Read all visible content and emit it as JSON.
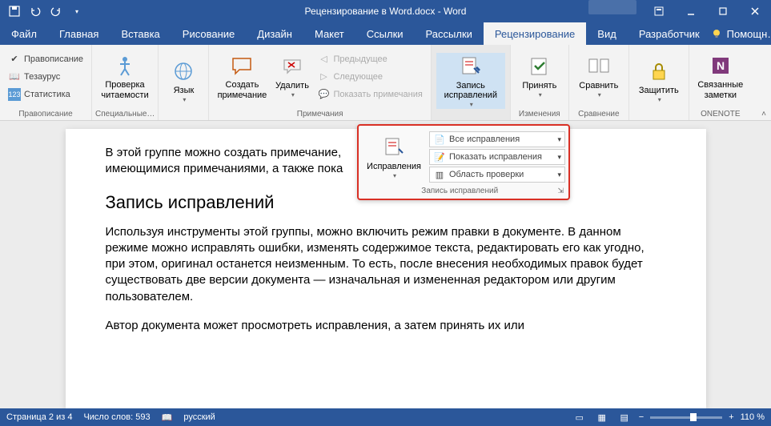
{
  "title": "Рецензирование в Word.docx - Word",
  "qat": {
    "save": "save-icon",
    "undo": "undo-icon",
    "redo": "redo-icon",
    "touch": "touch-icon"
  },
  "menu": {
    "tabs": [
      "Файл",
      "Главная",
      "Вставка",
      "Рисование",
      "Дизайн",
      "Макет",
      "Ссылки",
      "Рассылки",
      "Рецензирование",
      "Вид",
      "Разработчик"
    ],
    "active": 8,
    "help": "Помощн…"
  },
  "ribbon": {
    "groups": {
      "proofing": {
        "label": "Правописание",
        "spelling": "Правописание",
        "thesaurus": "Тезаурус",
        "stats": "Статистика"
      },
      "accessibility": {
        "label": "Специальные…",
        "check": "Проверка\nчитаемости"
      },
      "language": {
        "label": "",
        "lang": "Язык"
      },
      "comments": {
        "label": "Примечания",
        "new": "Создать\nпримечание",
        "delete": "Удалить",
        "prev": "Предыдущее",
        "next": "Следующее",
        "show": "Показать примечания"
      },
      "tracking": {
        "label": "",
        "track": "Запись\nисправлений"
      },
      "changes": {
        "label": "Изменения",
        "accept": "Принять"
      },
      "compare": {
        "label": "Сравнение",
        "compare": "Сравнить"
      },
      "protect": {
        "label": "",
        "protect": "Защитить"
      },
      "onenote": {
        "label": "ONENOTE",
        "linked": "Связанные\nзаметки"
      }
    }
  },
  "callout": {
    "track": "Исправления",
    "display": "Все исправления",
    "show": "Показать исправления",
    "pane": "Область проверки",
    "label": "Запись исправлений"
  },
  "document": {
    "p1": "В этой группе можно создать примечание,",
    "p1b": "имеющимися примечаниями, а также пока",
    "h1": "Запись исправлений",
    "p2": "Используя инструменты этой группы, можно включить режим правки в документе. В данном режиме можно исправлять ошибки, изменять содержимое текста, редактировать его как угодно, при этом, оригинал останется неизменным. То есть, после внесения необходимых правок будет существовать две версии документа — изначальная и измененная редактором или другим пользователем.",
    "p3": "Автор документа может просмотреть исправления, а затем принять их или"
  },
  "status": {
    "page": "Страница 2 из 4",
    "words": "Число слов: 593",
    "lang": "русский",
    "zoom": "110 %"
  }
}
